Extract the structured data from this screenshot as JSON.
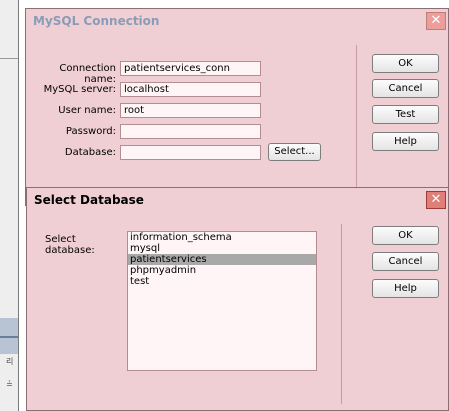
{
  "connection_dialog": {
    "title": "MySQL Connection",
    "close_glyph": "✕",
    "fields": [
      {
        "label": "Connection name:",
        "value": "patientservices_conn"
      },
      {
        "label": "MySQL server:",
        "value": "localhost"
      },
      {
        "label": "User name:",
        "value": "root"
      },
      {
        "label": "Password:",
        "value": ""
      },
      {
        "label": "Database:",
        "value": ""
      }
    ],
    "select_button": "Select...",
    "buttons": {
      "ok": "OK",
      "cancel": "Cancel",
      "test": "Test",
      "help": "Help"
    }
  },
  "select_db_dialog": {
    "title": "Select Database",
    "close_glyph": "✕",
    "label": "Select database:",
    "databases": [
      "information_schema",
      "mysql",
      "patientservices",
      "phpmyadmin",
      "test"
    ],
    "selected": "patientservices",
    "buttons": {
      "ok": "OK",
      "cancel": "Cancel",
      "help": "Help"
    }
  },
  "background_glyphs": {
    "a": "리",
    "b": "≟"
  },
  "colors": {
    "dialog_bg": "#f0cfd4",
    "close_button": "#df7f78",
    "selection": "#a8a8a8"
  }
}
